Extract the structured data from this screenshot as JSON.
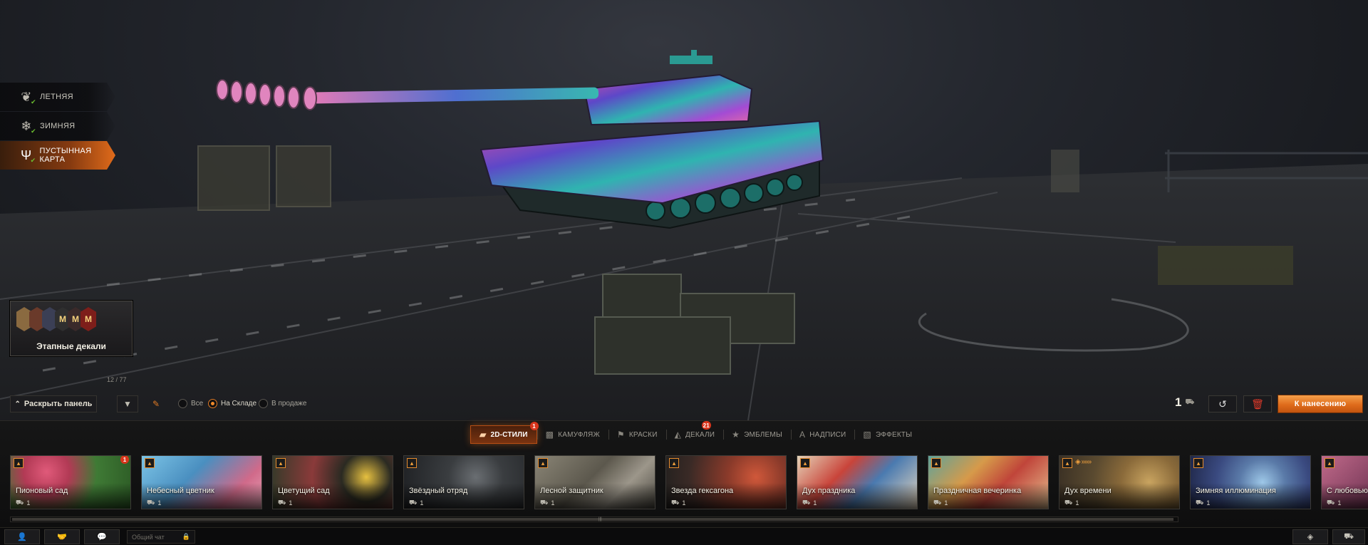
{
  "seasons": [
    {
      "label": "ЛЕТНЯЯ",
      "icon": "leaf-icon",
      "active": false
    },
    {
      "label": "ЗИМНЯЯ",
      "icon": "snowflake-icon",
      "active": false
    },
    {
      "label": "ПУСТЫННАЯ КАРТА",
      "icon": "cactus-icon",
      "active": true
    }
  ],
  "stage_decals": {
    "label": "Этапные декали",
    "badges": [
      "1",
      "2",
      "3",
      "4",
      "5",
      "6"
    ]
  },
  "counter_tag": "12 / 77",
  "filterbar": {
    "expand_label": "Раскрыть панель",
    "radios": [
      {
        "label": "Все",
        "selected": false
      },
      {
        "label": "На Складе",
        "selected": true
      },
      {
        "label": "В продаже",
        "selected": false
      }
    ]
  },
  "right_controls": {
    "count": "1",
    "apply_label": "К нанесению"
  },
  "tabs": [
    {
      "label": "2D-СТИЛИ",
      "icon": "brush-icon",
      "active": true,
      "badge": "1"
    },
    {
      "label": "КАМУФЛЯЖ",
      "icon": "camo-icon",
      "active": false,
      "badge": ""
    },
    {
      "label": "КРАСКИ",
      "icon": "paint-icon",
      "active": false,
      "badge": ""
    },
    {
      "label": "ДЕКАЛИ",
      "icon": "decal-icon",
      "active": false,
      "badge": "21"
    },
    {
      "label": "ЭМБЛЕМЫ",
      "icon": "star-icon",
      "active": false,
      "badge": ""
    },
    {
      "label": "НАДПИСИ",
      "icon": "letter-icon",
      "active": false,
      "badge": ""
    },
    {
      "label": "ЭФФЕКТЫ",
      "icon": "effects-icon",
      "active": false,
      "badge": ""
    }
  ],
  "cards": [
    {
      "name": "Пионовый сад",
      "qty": "1",
      "badge": "1",
      "extra": ""
    },
    {
      "name": "Небесный цветник",
      "qty": "1",
      "badge": "",
      "extra": ""
    },
    {
      "name": "Цветущий сад",
      "qty": "1",
      "badge": "",
      "extra": ""
    },
    {
      "name": "Звёздный отряд",
      "qty": "1",
      "badge": "",
      "extra": ""
    },
    {
      "name": "Лесной защитник",
      "qty": "1",
      "badge": "",
      "extra": ""
    },
    {
      "name": "Звезда гексагона",
      "qty": "1",
      "badge": "",
      "extra": ""
    },
    {
      "name": "Дух праздника",
      "qty": "1",
      "badge": "",
      "extra": ""
    },
    {
      "name": "Праздничная вечеринка",
      "qty": "1",
      "badge": "",
      "extra": ""
    },
    {
      "name": "Дух времени",
      "qty": "1",
      "badge": "",
      "extra": "◈ »»»"
    },
    {
      "name": "Зимняя иллюминация",
      "qty": "1",
      "badge": "",
      "extra": ""
    },
    {
      "name": "С любовью",
      "qty": "1",
      "badge": "",
      "extra": ""
    }
  ],
  "chat_placeholder": "Общий чат",
  "colors": {
    "accent": "#e46d1b",
    "badge": "#d8351c",
    "check": "#6cbf2f"
  }
}
